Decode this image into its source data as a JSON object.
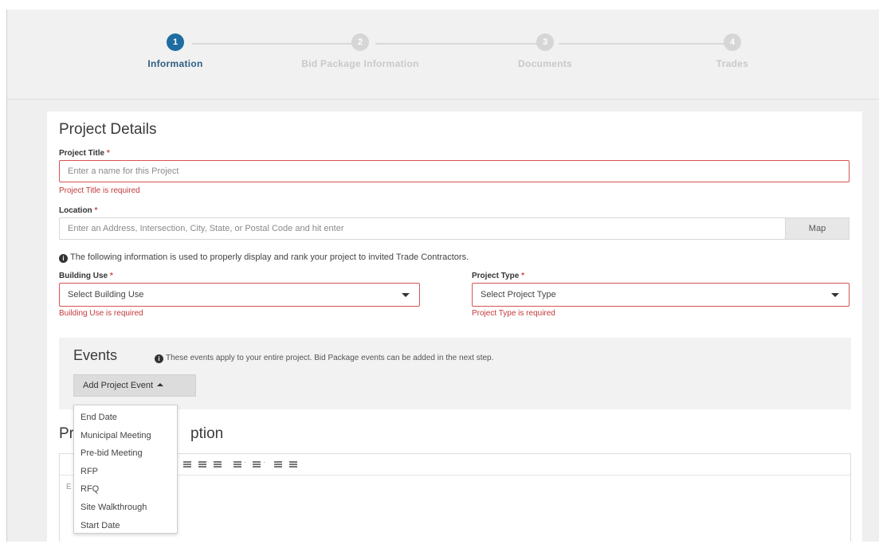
{
  "steps": [
    {
      "number": "1",
      "label": "Information"
    },
    {
      "number": "2",
      "label": "Bid Package Information"
    },
    {
      "number": "3",
      "label": "Documents"
    },
    {
      "number": "4",
      "label": "Trades"
    }
  ],
  "project_details": {
    "title": "Project Details",
    "project_title": {
      "label": "Project Title",
      "required_mark": "*",
      "placeholder": "Enter a name for this Project",
      "error": "Project Title is required"
    },
    "location": {
      "label": "Location",
      "required_mark": "*",
      "placeholder": "Enter an Address, Intersection, City, State, or Postal Code and hit enter",
      "map_button": "Map"
    },
    "info_text": "The following information is used to properly display and rank your project to invited Trade Contractors.",
    "building_use": {
      "label": "Building Use",
      "required_mark": "*",
      "value": "Select Building Use",
      "error": "Building Use is required"
    },
    "project_type": {
      "label": "Project Type",
      "required_mark": "*",
      "value": "Select Project Type",
      "error": "Project Type is required"
    }
  },
  "events": {
    "title": "Events",
    "note": "These events apply to your entire project. Bid Package events can be added in the next step.",
    "add_button": "Add Project Event",
    "menu": [
      "End Date",
      "Municipal Meeting",
      "Pre-bid Meeting",
      "RFP",
      "RFQ",
      "Site Walkthrough",
      "Start Date"
    ]
  },
  "description": {
    "title_left": "Pr",
    "title_right": "ption",
    "placeholder_partial": "E"
  },
  "colors": {
    "accent": "#1e6da1",
    "error": "#d65454",
    "inactive_step": "#d6d6d6"
  }
}
